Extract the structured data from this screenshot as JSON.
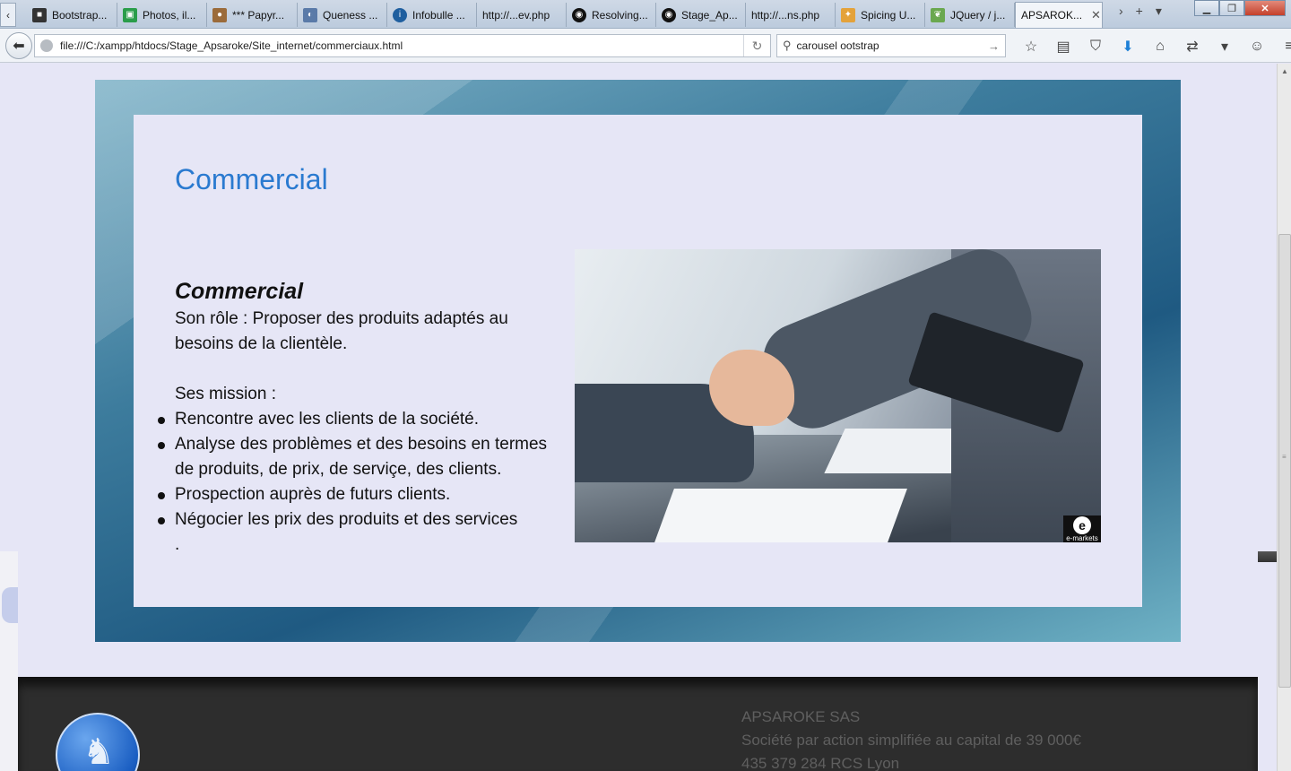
{
  "tabs": [
    {
      "label": "Bootstrap...",
      "icon": "bootstrap-icon",
      "color": "#333333"
    },
    {
      "label": "Photos, il...",
      "icon": "photos-icon",
      "color": "#2a9d4a"
    },
    {
      "label": "*** Papyr...",
      "icon": "papyrus-icon",
      "color": "#9b6b3a"
    },
    {
      "label": "Queness ...",
      "icon": "queness-icon",
      "color": "#5a7aa8"
    },
    {
      "label": "Infobulle ...",
      "icon": "infobulle-icon",
      "color": "#1f5f9f"
    },
    {
      "label": "http://...ev.php",
      "icon": "",
      "color": ""
    },
    {
      "label": "Resolving...",
      "icon": "github-icon",
      "color": "#111111"
    },
    {
      "label": "Stage_Ap...",
      "icon": "github-icon",
      "color": "#111111"
    },
    {
      "label": "http://...ns.php",
      "icon": "",
      "color": ""
    },
    {
      "label": "Spicing U...",
      "icon": "spicing-icon",
      "color": "#e4a23a"
    },
    {
      "label": "JQuery / j...",
      "icon": "jquery-icon",
      "color": "#6aa84f"
    },
    {
      "label": "APSAROK...",
      "icon": "",
      "color": "",
      "active": true
    }
  ],
  "navbar": {
    "url": "file:///C:/xampp/htdocs/Stage_Apsaroke/Site_internet/commerciaux.html",
    "search_value": "carousel ootstrap"
  },
  "page": {
    "heading": "Commercial",
    "role_title": "Commercial",
    "role_lines": [
      "Son rôle : Proposer des produits adaptés au",
      "besoins de la clientèle."
    ],
    "missions_intro": "Ses mission :",
    "missions": [
      "Rencontre avec les clients de la société.",
      "Analyse des problèmes et des besoins en termes de produits, de prix, de serviçe, des clients.",
      "Prospection auprès de futurs clients.",
      "Négocier les prix des produits et des services"
    ],
    "trailing": ".",
    "photo_logo_caption": "e-markets"
  },
  "footer": {
    "company_name": "APSAROKE SAS",
    "company_type": "Société par action simplifiée au capital de 39 000€",
    "registration": "435 379 284 RCS Lyon"
  },
  "colors": {
    "heading": "#2a7ad0",
    "card_background": "#e6e6f6",
    "footer_background": "#2d2d2d",
    "footer_text": "#5f5f5f"
  }
}
